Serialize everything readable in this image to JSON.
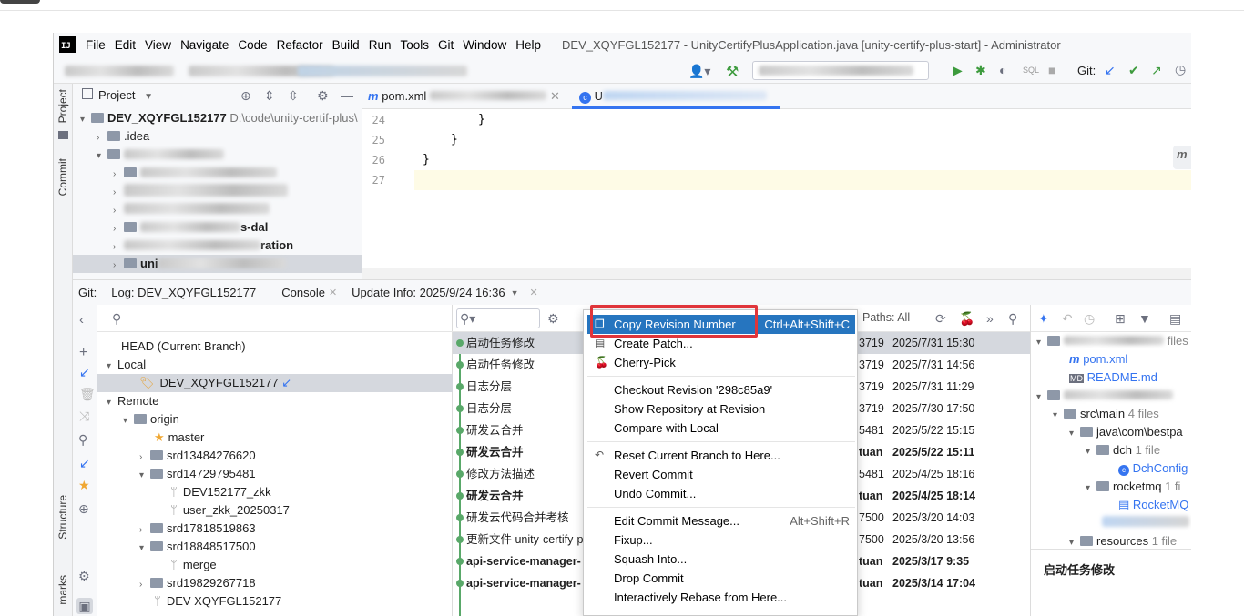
{
  "window": {
    "title": "DEV_XQYFGL152177 - UnityCertifyPlusApplication.java [unity-certify-plus-start] - Administrator"
  },
  "menu": [
    "File",
    "Edit",
    "View",
    "Navigate",
    "Code",
    "Refactor",
    "Build",
    "Run",
    "Tools",
    "Git",
    "Window",
    "Help"
  ],
  "toolbar": {
    "git_label": "Git:",
    "sql_label": "SQL"
  },
  "left_strip": {
    "project": "Project",
    "commit": "Commit",
    "structure": "Structure",
    "bookmarks": "marks"
  },
  "project": {
    "header": "Project",
    "root": "DEV_XQYFGL152177",
    "root_path": "D:\\code\\unity-certif-plus\\",
    "idea": ".idea",
    "dal": "s-dal",
    "integration": "ration",
    "unity": "uni"
  },
  "editor": {
    "tab1": "pom.xml",
    "tab2": "U",
    "lines": [
      "24",
      "25",
      "26",
      "27"
    ],
    "code": [
      "}",
      "}",
      "}",
      ""
    ]
  },
  "git": {
    "label": "Git:",
    "log_tab": "Log: DEV_XQYFGL152177",
    "console_tab": "Console",
    "update_tab": "Update Info: 2025/9/24 16:36",
    "paths": "Paths: All"
  },
  "branches": {
    "head": "HEAD (Current Branch)",
    "local": "Local",
    "current": "DEV_XQYFGL152177",
    "remote": "Remote",
    "origin": "origin",
    "items": [
      "master",
      "srd13484276620",
      "srd14729795481",
      "DEV152177_zkk",
      "user_zkk_20250317",
      "srd17818519863",
      "srd18848517500",
      "merge",
      "srd19829267718",
      "DEV XQYFGL152177"
    ]
  },
  "commits": [
    {
      "msg": "启动任务修改",
      "hash": "3719",
      "date": "2025/7/31 15:30",
      "bold": false
    },
    {
      "msg": "启动任务修改",
      "hash": "3719",
      "date": "2025/7/31 14:56",
      "bold": false
    },
    {
      "msg": "日志分层",
      "hash": "3719",
      "date": "2025/7/31 11:29",
      "bold": false
    },
    {
      "msg": "日志分层",
      "hash": "3719",
      "date": "2025/7/30 17:50",
      "bold": false
    },
    {
      "msg": "研发云合并",
      "hash": "5481",
      "date": "2025/5/22 15:15",
      "bold": false
    },
    {
      "msg": "研发云合并",
      "hash": "tuan",
      "date": "2025/5/22 15:11",
      "bold": true
    },
    {
      "msg": "修改方法描述",
      "hash": "5481",
      "date": "2025/4/25 18:16",
      "bold": false
    },
    {
      "msg": "研发云合并",
      "hash": "tuan",
      "date": "2025/4/25 18:14",
      "bold": true
    },
    {
      "msg": "研发云代码合并考核",
      "hash": "7500",
      "date": "2025/3/20 14:03",
      "bold": false
    },
    {
      "msg": "更新文件 unity-certify-p",
      "hash": "7500",
      "date": "2025/3/20 13:56",
      "bold": false
    },
    {
      "msg": "api-service-manager-",
      "hash": "tuan",
      "date": "2025/3/17 9:35",
      "bold": true
    },
    {
      "msg": "api-service-manager-",
      "hash": "tuan",
      "date": "2025/3/14 17:04",
      "bold": true
    }
  ],
  "context_menu": {
    "copy": "Copy Revision Number",
    "copy_sc": "Ctrl+Alt+Shift+C",
    "patch": "Create Patch...",
    "cherry": "Cherry-Pick",
    "checkout": "Checkout Revision '298c85a9'",
    "show_repo": "Show Repository at Revision",
    "compare": "Compare with Local",
    "reset": "Reset Current Branch to Here...",
    "revert": "Revert Commit",
    "undo": "Undo Commit...",
    "edit_msg": "Edit Commit Message...",
    "edit_sc": "Alt+Shift+R",
    "fixup": "Fixup...",
    "squash": "Squash Into...",
    "drop": "Drop Commit",
    "rebase": "Interactively Rebase from Here..."
  },
  "changes": {
    "files_label": "files",
    "pom": "pom.xml",
    "readme": "README.md",
    "src_main": "src\\main",
    "src_count": "4 files",
    "java_path": "java\\com\\bestpa",
    "dch": "dch",
    "dch_count": "1 file",
    "dch_cfg": "DchConfig",
    "rocketmq": "rocketmq",
    "rocket_count": "1 fi",
    "rocket_file": "RocketMQ",
    "resources": "resources",
    "res_count": "1 file",
    "commit_msg": "启动任务修改"
  }
}
